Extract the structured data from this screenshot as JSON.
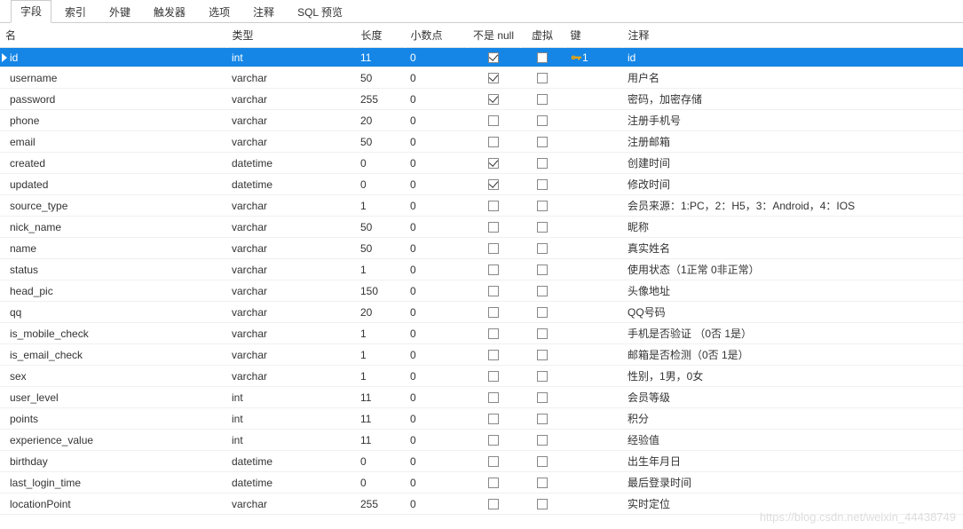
{
  "tabs": [
    {
      "label": "字段",
      "active": true
    },
    {
      "label": "索引",
      "active": false
    },
    {
      "label": "外键",
      "active": false
    },
    {
      "label": "触发器",
      "active": false
    },
    {
      "label": "选项",
      "active": false
    },
    {
      "label": "注释",
      "active": false
    },
    {
      "label": "SQL 预览",
      "active": false
    }
  ],
  "columns": {
    "name": "名",
    "type": "类型",
    "length": "长度",
    "decimals": "小数点",
    "notnull": "不是 null",
    "virtual": "虚拟",
    "key": "键",
    "comment": "注释"
  },
  "rows": [
    {
      "name": "id",
      "type": "int",
      "length": "11",
      "decimals": "0",
      "notnull": true,
      "virtual": false,
      "key": "1",
      "comment": "id",
      "selected": true
    },
    {
      "name": "username",
      "type": "varchar",
      "length": "50",
      "decimals": "0",
      "notnull": true,
      "virtual": false,
      "key": "",
      "comment": "用户名"
    },
    {
      "name": "password",
      "type": "varchar",
      "length": "255",
      "decimals": "0",
      "notnull": true,
      "virtual": false,
      "key": "",
      "comment": "密码，加密存储"
    },
    {
      "name": "phone",
      "type": "varchar",
      "length": "20",
      "decimals": "0",
      "notnull": false,
      "virtual": false,
      "key": "",
      "comment": "注册手机号"
    },
    {
      "name": "email",
      "type": "varchar",
      "length": "50",
      "decimals": "0",
      "notnull": false,
      "virtual": false,
      "key": "",
      "comment": "注册邮箱"
    },
    {
      "name": "created",
      "type": "datetime",
      "length": "0",
      "decimals": "0",
      "notnull": true,
      "virtual": false,
      "key": "",
      "comment": "创建时间"
    },
    {
      "name": "updated",
      "type": "datetime",
      "length": "0",
      "decimals": "0",
      "notnull": true,
      "virtual": false,
      "key": "",
      "comment": "修改时间"
    },
    {
      "name": "source_type",
      "type": "varchar",
      "length": "1",
      "decimals": "0",
      "notnull": false,
      "virtual": false,
      "key": "",
      "comment": "会员来源：1:PC，2：H5，3：Android，4：IOS"
    },
    {
      "name": "nick_name",
      "type": "varchar",
      "length": "50",
      "decimals": "0",
      "notnull": false,
      "virtual": false,
      "key": "",
      "comment": "昵称"
    },
    {
      "name": "name",
      "type": "varchar",
      "length": "50",
      "decimals": "0",
      "notnull": false,
      "virtual": false,
      "key": "",
      "comment": "真实姓名"
    },
    {
      "name": "status",
      "type": "varchar",
      "length": "1",
      "decimals": "0",
      "notnull": false,
      "virtual": false,
      "key": "",
      "comment": "使用状态（1正常 0非正常）"
    },
    {
      "name": "head_pic",
      "type": "varchar",
      "length": "150",
      "decimals": "0",
      "notnull": false,
      "virtual": false,
      "key": "",
      "comment": "头像地址"
    },
    {
      "name": "qq",
      "type": "varchar",
      "length": "20",
      "decimals": "0",
      "notnull": false,
      "virtual": false,
      "key": "",
      "comment": "QQ号码"
    },
    {
      "name": "is_mobile_check",
      "type": "varchar",
      "length": "1",
      "decimals": "0",
      "notnull": false,
      "virtual": false,
      "key": "",
      "comment": "手机是否验证 （0否  1是）"
    },
    {
      "name": "is_email_check",
      "type": "varchar",
      "length": "1",
      "decimals": "0",
      "notnull": false,
      "virtual": false,
      "key": "",
      "comment": "邮箱是否检测（0否  1是）"
    },
    {
      "name": "sex",
      "type": "varchar",
      "length": "1",
      "decimals": "0",
      "notnull": false,
      "virtual": false,
      "key": "",
      "comment": "性别，1男，0女"
    },
    {
      "name": "user_level",
      "type": "int",
      "length": "11",
      "decimals": "0",
      "notnull": false,
      "virtual": false,
      "key": "",
      "comment": "会员等级"
    },
    {
      "name": "points",
      "type": "int",
      "length": "11",
      "decimals": "0",
      "notnull": false,
      "virtual": false,
      "key": "",
      "comment": "积分"
    },
    {
      "name": "experience_value",
      "type": "int",
      "length": "11",
      "decimals": "0",
      "notnull": false,
      "virtual": false,
      "key": "",
      "comment": "经验值"
    },
    {
      "name": "birthday",
      "type": "datetime",
      "length": "0",
      "decimals": "0",
      "notnull": false,
      "virtual": false,
      "key": "",
      "comment": "出生年月日"
    },
    {
      "name": "last_login_time",
      "type": "datetime",
      "length": "0",
      "decimals": "0",
      "notnull": false,
      "virtual": false,
      "key": "",
      "comment": "最后登录时间"
    },
    {
      "name": "locationPoint",
      "type": "varchar",
      "length": "255",
      "decimals": "0",
      "notnull": false,
      "virtual": false,
      "key": "",
      "comment": "实时定位"
    }
  ],
  "watermark": "https://blog.csdn.net/weixin_44438749"
}
